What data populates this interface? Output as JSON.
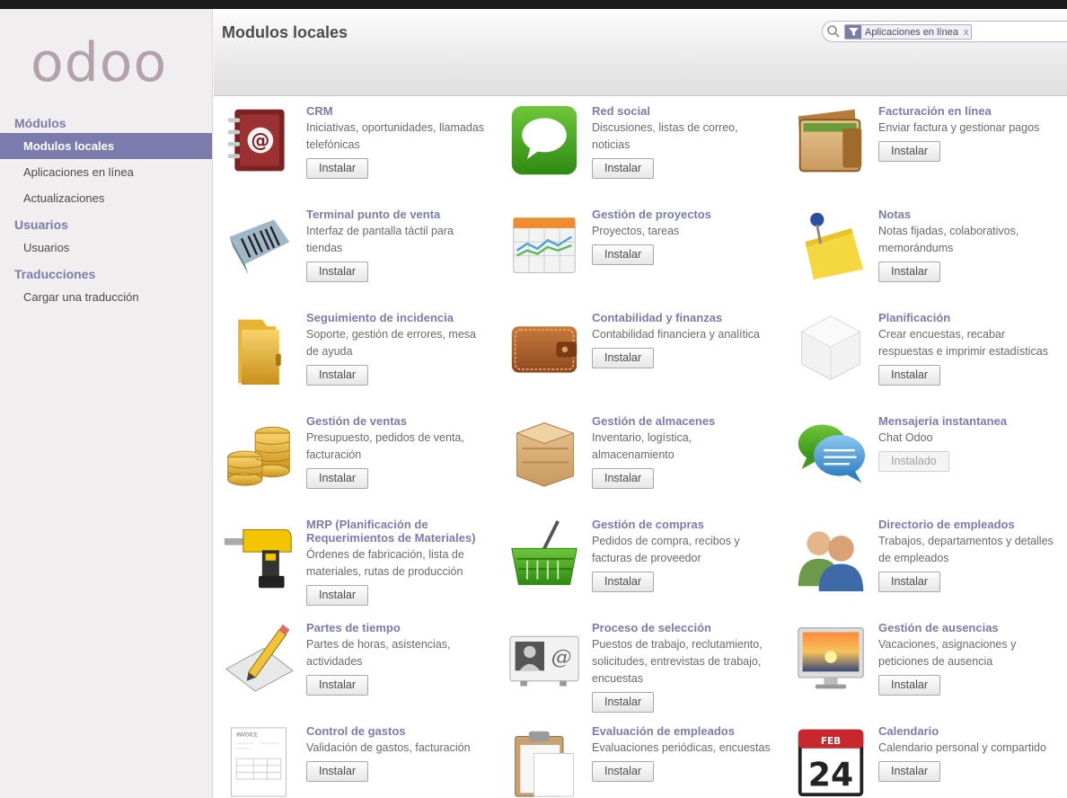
{
  "brand": {
    "logo_text": "odoo"
  },
  "sidebar": {
    "sections": [
      {
        "title": "Módulos",
        "items": [
          "Modulos locales",
          "Aplicaciones en línea",
          "Actualizaciones"
        ]
      },
      {
        "title": "Usuarios",
        "items": [
          "Usuarios"
        ]
      },
      {
        "title": "Traducciones",
        "items": [
          "Cargar una traducción"
        ]
      }
    ],
    "active_item": "Modulos locales"
  },
  "header": {
    "title": "Modulos locales",
    "search": {
      "facet_value": "Aplicaciones en línea",
      "facet_remove": "x"
    }
  },
  "modules": [
    {
      "name": "CRM",
      "desc": "Iniciativas, oportunidades, llamadas telefónicas",
      "button": "Instalar",
      "icon": "address-book-icon",
      "installed": false
    },
    {
      "name": "Red social",
      "desc": "Discusiones, listas de correo, noticias",
      "button": "Instalar",
      "icon": "chat-bubble-icon",
      "installed": false
    },
    {
      "name": "Facturación en línea",
      "desc": "Enviar factura y gestionar pagos",
      "button": "Instalar",
      "icon": "wallet-open-icon",
      "installed": false
    },
    {
      "name": "Terminal punto de venta",
      "desc": "Interfaz de pantalla táctil para tiendas",
      "button": "Instalar",
      "icon": "barcode-scanner-icon",
      "installed": false
    },
    {
      "name": "Gestión de proyectos",
      "desc": "Proyectos, tareas",
      "button": "Instalar",
      "icon": "calendar-chart-icon",
      "installed": false
    },
    {
      "name": "Notas",
      "desc": "Notas fijadas, colaborativos, memorándums",
      "button": "Instalar",
      "icon": "sticky-note-icon",
      "installed": false
    },
    {
      "name": "Seguimiento de incidencia",
      "desc": "Soporte, gestión de errores, mesa de ayuda",
      "button": "Instalar",
      "icon": "folder-icon",
      "installed": false
    },
    {
      "name": "Contabilidad y finanzas",
      "desc": "Contabilidad financiera y analítica",
      "button": "Instalar",
      "icon": "wallet-icon",
      "installed": false
    },
    {
      "name": "Planificación",
      "desc": "Crear encuestas, recabar respuestas e imprimir estadísticas",
      "button": "Instalar",
      "icon": "cube-icon",
      "installed": false
    },
    {
      "name": "Gestión de ventas",
      "desc": "Presupuesto, pedidos de venta, facturación",
      "button": "Instalar",
      "icon": "coins-icon",
      "installed": false
    },
    {
      "name": "Gestión de almacenes",
      "desc": "Inventario, logística, almacenamiento",
      "button": "Instalar",
      "icon": "wooden-crate-icon",
      "installed": false
    },
    {
      "name": "Mensajeria instantanea",
      "desc": "Chat Odoo",
      "button": "Instalado",
      "icon": "chat-bubbles-icon",
      "installed": true
    },
    {
      "name": "MRP (Planificación de Requerimientos de Materiales)",
      "desc": "Órdenes de fabricación, lista de materiales, rutas de producción",
      "button": "Instalar",
      "icon": "drill-icon",
      "installed": false
    },
    {
      "name": "Gestión de compras",
      "desc": "Pedidos de compra, recibos y facturas de proveedor",
      "button": "Instalar",
      "icon": "shopping-basket-icon",
      "installed": false
    },
    {
      "name": "Directorio de empleados",
      "desc": "Trabajos, departamentos y detalles de empleados",
      "button": "Instalar",
      "icon": "people-icon",
      "installed": false
    },
    {
      "name": "Partes de tiempo",
      "desc": "Partes de horas, asistencias, actividades",
      "button": "Instalar",
      "icon": "pencil-paper-icon",
      "installed": false
    },
    {
      "name": "Proceso de selección",
      "desc": "Puestos de trabajo, reclutamiento, solicitudes, entrevistas de trabajo, encuestas",
      "button": "Instalar",
      "icon": "contact-card-icon",
      "installed": false
    },
    {
      "name": "Gestión de ausencias",
      "desc": "Vacaciones, asignaciones y peticiones de ausencia",
      "button": "Instalar",
      "icon": "monitor-sunset-icon",
      "installed": false
    },
    {
      "name": "Control de gastos",
      "desc": "Validación de gastos, facturación",
      "button": "Instalar",
      "icon": "invoice-icon",
      "installed": false
    },
    {
      "name": "Evaluación de empleados",
      "desc": "Evaluaciones periódicas, encuestas",
      "button": "Instalar",
      "icon": "clipboard-icon",
      "installed": false
    },
    {
      "name": "Calendario",
      "desc": "Calendario personal y compartido",
      "button": "Instalar",
      "icon": "calendar-icon",
      "installed": false
    }
  ],
  "icon_texts": {
    "calendar_month": "FEB",
    "calendar_day": "24",
    "invoice_label": "INVOICE"
  },
  "colors": {
    "accent": "#7c7bad",
    "logo": "#a24689"
  }
}
